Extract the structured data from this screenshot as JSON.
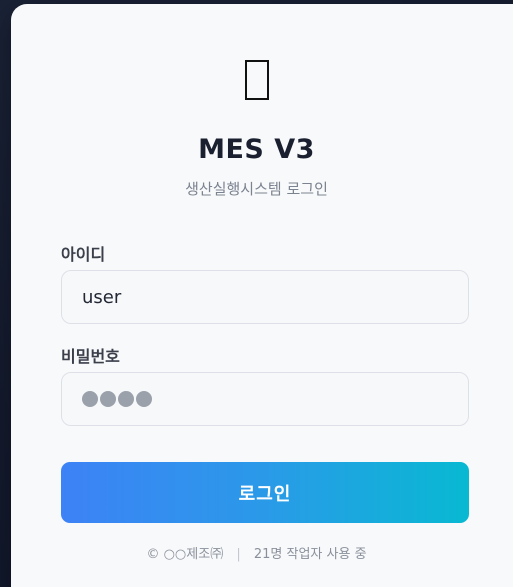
{
  "app": {
    "logo_icon": "missing-glyph-icon",
    "title": "MES V3",
    "subtitle": "생산실행시스템 로그인"
  },
  "form": {
    "username_label": "아이디",
    "username_value": "user",
    "password_label": "비밀번호",
    "password_mask": "●●●●",
    "password_length": 4,
    "login_label": "로그인"
  },
  "footer": {
    "copyright": "© ○○제조㈜",
    "separator": "|",
    "status": "21명 작업자 사용 중"
  },
  "colors": {
    "button_gradient_start": "#3d82f6",
    "button_gradient_end": "#08b9d2",
    "background": "#141b2e",
    "card": "#f8f9fa"
  }
}
